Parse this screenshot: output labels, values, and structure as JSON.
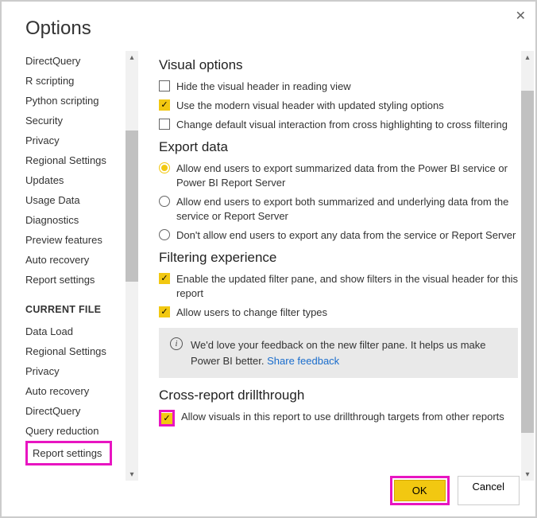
{
  "title": "Options",
  "sidebar": {
    "global_items": [
      "DirectQuery",
      "R scripting",
      "Python scripting",
      "Security",
      "Privacy",
      "Regional Settings",
      "Updates",
      "Usage Data",
      "Diagnostics",
      "Preview features",
      "Auto recovery",
      "Report settings"
    ],
    "section_header": "CURRENT FILE",
    "file_items": [
      "Data Load",
      "Regional Settings",
      "Privacy",
      "Auto recovery",
      "DirectQuery",
      "Query reduction",
      "Report settings"
    ]
  },
  "main": {
    "visual_options": {
      "heading": "Visual options",
      "cb1": {
        "label": "Hide the visual header in reading view",
        "checked": false
      },
      "cb2": {
        "label": "Use the modern visual header with updated styling options",
        "checked": true
      },
      "cb3": {
        "label": "Change default visual interaction from cross highlighting to cross filtering",
        "checked": false
      }
    },
    "export": {
      "heading": "Export data",
      "r1": {
        "label": "Allow end users to export summarized data from the Power BI service or Power BI Report Server",
        "checked": true
      },
      "r2": {
        "label": "Allow end users to export both summarized and underlying data from the service or Report Server",
        "checked": false
      },
      "r3": {
        "label": "Don't allow end users to export any data from the service or Report Server",
        "checked": false
      }
    },
    "filtering": {
      "heading": "Filtering experience",
      "cb1": {
        "label": "Enable the updated filter pane, and show filters in the visual header for this report",
        "checked": true
      },
      "cb2": {
        "label": "Allow users to change filter types",
        "checked": true
      }
    },
    "feedback": {
      "text": "We'd love your feedback on the new filter pane. It helps us make Power BI better. ",
      "link": "Share feedback"
    },
    "cross": {
      "heading": "Cross-report drillthrough",
      "cb1": {
        "label": "Allow visuals in this report to use drillthrough targets from other reports",
        "checked": true
      }
    }
  },
  "footer": {
    "ok": "OK",
    "cancel": "Cancel"
  }
}
